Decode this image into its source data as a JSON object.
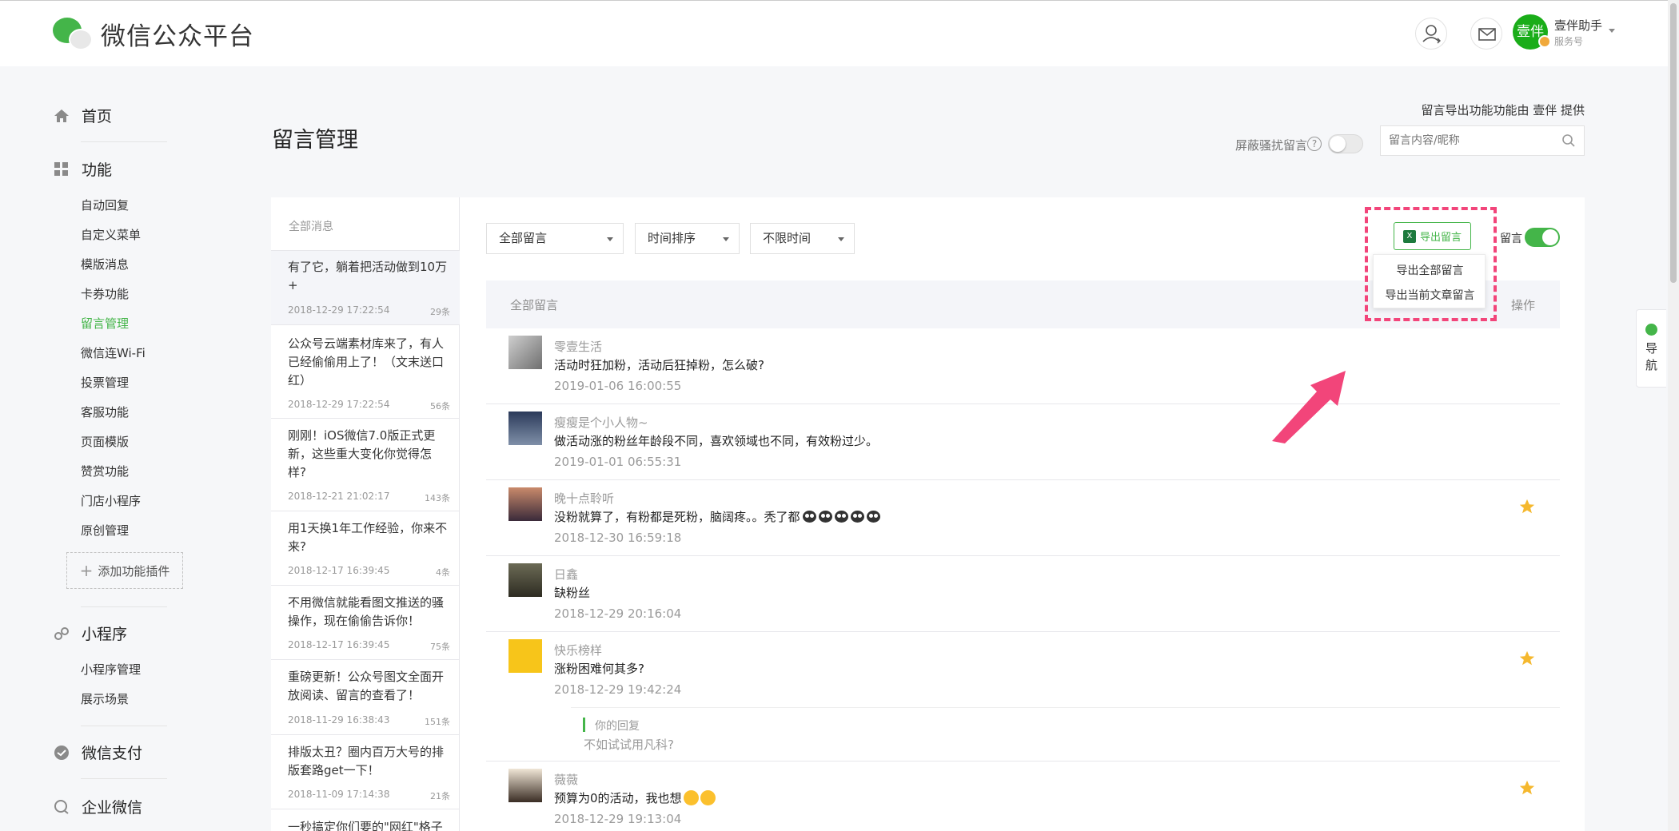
{
  "header": {
    "logo_text": "微信公众平台",
    "account_avatar_text": "壹伴",
    "account_name": "壹伴助手",
    "account_type": "服务号"
  },
  "sidebar": {
    "sections": [
      {
        "label": "首页",
        "icon": "home-icon"
      },
      {
        "label": "功能",
        "icon": "grid-icon"
      },
      {
        "label": "小程序",
        "icon": "mini-program-icon"
      },
      {
        "label": "微信支付",
        "icon": "wechat-pay-icon"
      },
      {
        "label": "企业微信",
        "icon": "work-wechat-icon"
      }
    ],
    "function_items": [
      "自动回复",
      "自定义菜单",
      "模版消息",
      "卡券功能",
      "留言管理",
      "微信连Wi-Fi",
      "投票管理",
      "客服功能",
      "页面模版",
      "赞赏功能",
      "门店小程序",
      "原创管理"
    ],
    "active_item": "留言管理",
    "add_plugin": "添加功能插件",
    "mini_items": [
      "小程序管理",
      "展示场景"
    ]
  },
  "page": {
    "title": "留言管理",
    "export_credit": "留言导出功能功能由 壹伴 提供",
    "mask_label": "屏蔽骚扰留言",
    "help_glyph": "?",
    "search_placeholder": "留言内容/昵称"
  },
  "articles": {
    "header": "全部消息",
    "items": [
      {
        "title": "有了它，躺着把活动做到10万+",
        "date": "2018-12-29 17:22:54",
        "count": "29条"
      },
      {
        "title": "公众号云端素材库来了，有人已经偷偷用上了！（文末送口红）",
        "date": "2018-12-29 17:22:54",
        "count": "56条"
      },
      {
        "title": "刚刚！iOS微信7.0版正式更新，这些重大变化你觉得怎样?",
        "date": "2018-12-21 21:02:17",
        "count": "143条"
      },
      {
        "title": "用1天换1年工作经验，你来不来?",
        "date": "2018-12-17 16:39:45",
        "count": "4条"
      },
      {
        "title": "不用微信就能看图文推送的骚操作，现在偷偷告诉你！",
        "date": "2018-12-17 16:39:45",
        "count": "75条"
      },
      {
        "title": "重磅更新！公众号图文全面开放阅读、留言的查看了！",
        "date": "2018-11-29 16:38:43",
        "count": "151条"
      },
      {
        "title": "排版太丑？圈内百万大号的排版套路get一下！",
        "date": "2018-11-09 17:14:38",
        "count": "21条"
      },
      {
        "title": "一秒搞定你们要的\"网红\"格子",
        "date": "",
        "count": ""
      }
    ]
  },
  "filters": [
    "全部留言",
    "时间排序",
    "不限时间"
  ],
  "export": {
    "button": "导出留言",
    "xls_glyph": "X",
    "menu": [
      "导出全部留言",
      "导出当前文章留言"
    ],
    "comment_toggle_label": "留言",
    "comment_toggle_on": true
  },
  "table": {
    "header": "全部留言",
    "op_header": "操作"
  },
  "comments": [
    {
      "name": "零壹生活",
      "text": "活动时狂加粉，活动后狂掉粉，怎么破?",
      "time": "2019-01-06 16:00:55",
      "starred": false
    },
    {
      "name": "瘦瘦是个小人物~",
      "text": "做活动涨的粉丝年龄段不同，喜欢领域也不同，有效粉过少。",
      "time": "2019-01-01 06:55:31",
      "starred": false
    },
    {
      "name": "晚十点聆听",
      "text": "没粉就算了，有粉都是死粉，脑阔疼。。秃了都",
      "time": "2018-12-30 16:59:18",
      "starred": true
    },
    {
      "name": "日鑫",
      "text": "缺粉丝",
      "time": "2018-12-29 20:16:04",
      "starred": false
    },
    {
      "name": "快乐榜样",
      "text": "涨粉困难何其多?",
      "time": "2018-12-29 19:42:24",
      "starred": true
    },
    {
      "name": "薇薇",
      "text": "预算为0的活动，我也想",
      "time": "2018-12-29 19:13:04",
      "starred": true
    }
  ],
  "reply": {
    "label": "你的回复",
    "text": "不如试试用凡科?"
  },
  "side_nav": {
    "label": "导航"
  },
  "colors": {
    "brand_green": "#44b549",
    "highlight_pink": "#f2457a",
    "star_yellow": "#f5b82e"
  }
}
